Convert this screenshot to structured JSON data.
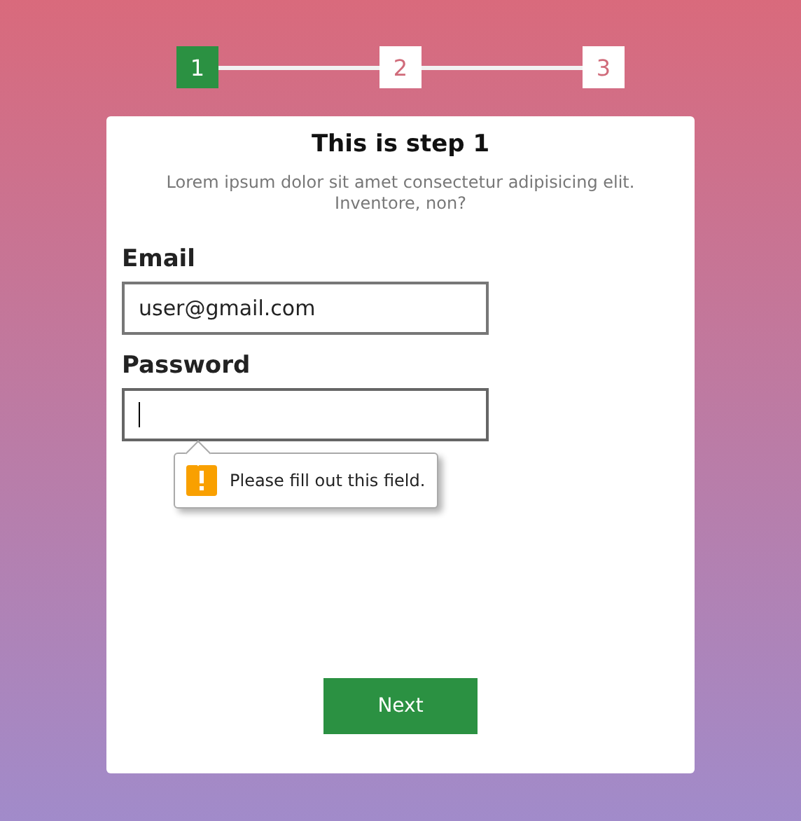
{
  "steps": [
    {
      "label": "1",
      "selected": true
    },
    {
      "label": "2",
      "selected": false
    },
    {
      "label": "3",
      "selected": false
    }
  ],
  "card": {
    "title": "This is step 1",
    "description": "Lorem ipsum dolor sit amet consectetur adipisicing elit. Inventore, non?",
    "fields": [
      {
        "label": "Email",
        "value": "user@gmail.com",
        "focused": false
      },
      {
        "label": "Password",
        "focused": true,
        "tooltip": "Please fill out this field."
      }
    ],
    "button": "Next"
  }
}
